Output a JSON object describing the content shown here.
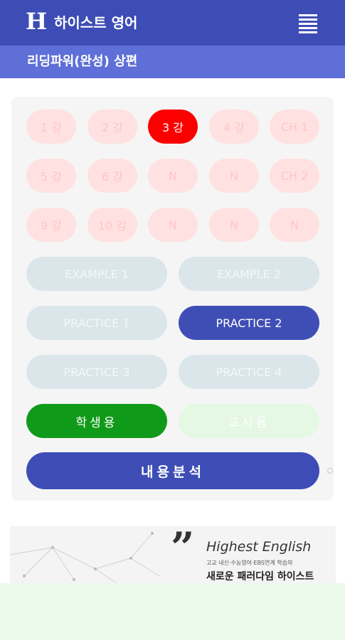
{
  "header": {
    "logo": "H",
    "title": "하이스트 영어"
  },
  "subheader": {
    "title": "리딩파워(완성) 상편"
  },
  "lessons": {
    "row1": [
      "1 강",
      "2 강",
      "3 강",
      "4 강",
      "CH 1"
    ],
    "row2": [
      "5 강",
      "6 강",
      "N",
      "N",
      "CH 2"
    ],
    "row3": [
      "9 강",
      "10 강",
      "N",
      "N",
      "N"
    ],
    "active": "3 강"
  },
  "sections": {
    "example1": "EXAMPLE 1",
    "example2": "EXAMPLE 2",
    "practice1": "PRACTICE 1",
    "practice2": "PRACTICE 2",
    "practice3": "PRACTICE 3",
    "practice4": "PRACTICE 4",
    "active": "PRACTICE 2"
  },
  "modes": {
    "student": "학생용",
    "teacher": "교사용"
  },
  "analysis": {
    "label": "내용분석"
  },
  "banner": {
    "title": "Highest English",
    "small": "고교 내신·수능영어·EBS연계 학습의",
    "subtitle": "새로운 패러다임 하이스트"
  },
  "colors": {
    "primary": "#3d4db5",
    "subheader": "#5e6fd8",
    "active_lesson": "#fc0000",
    "student": "#109a1a"
  }
}
